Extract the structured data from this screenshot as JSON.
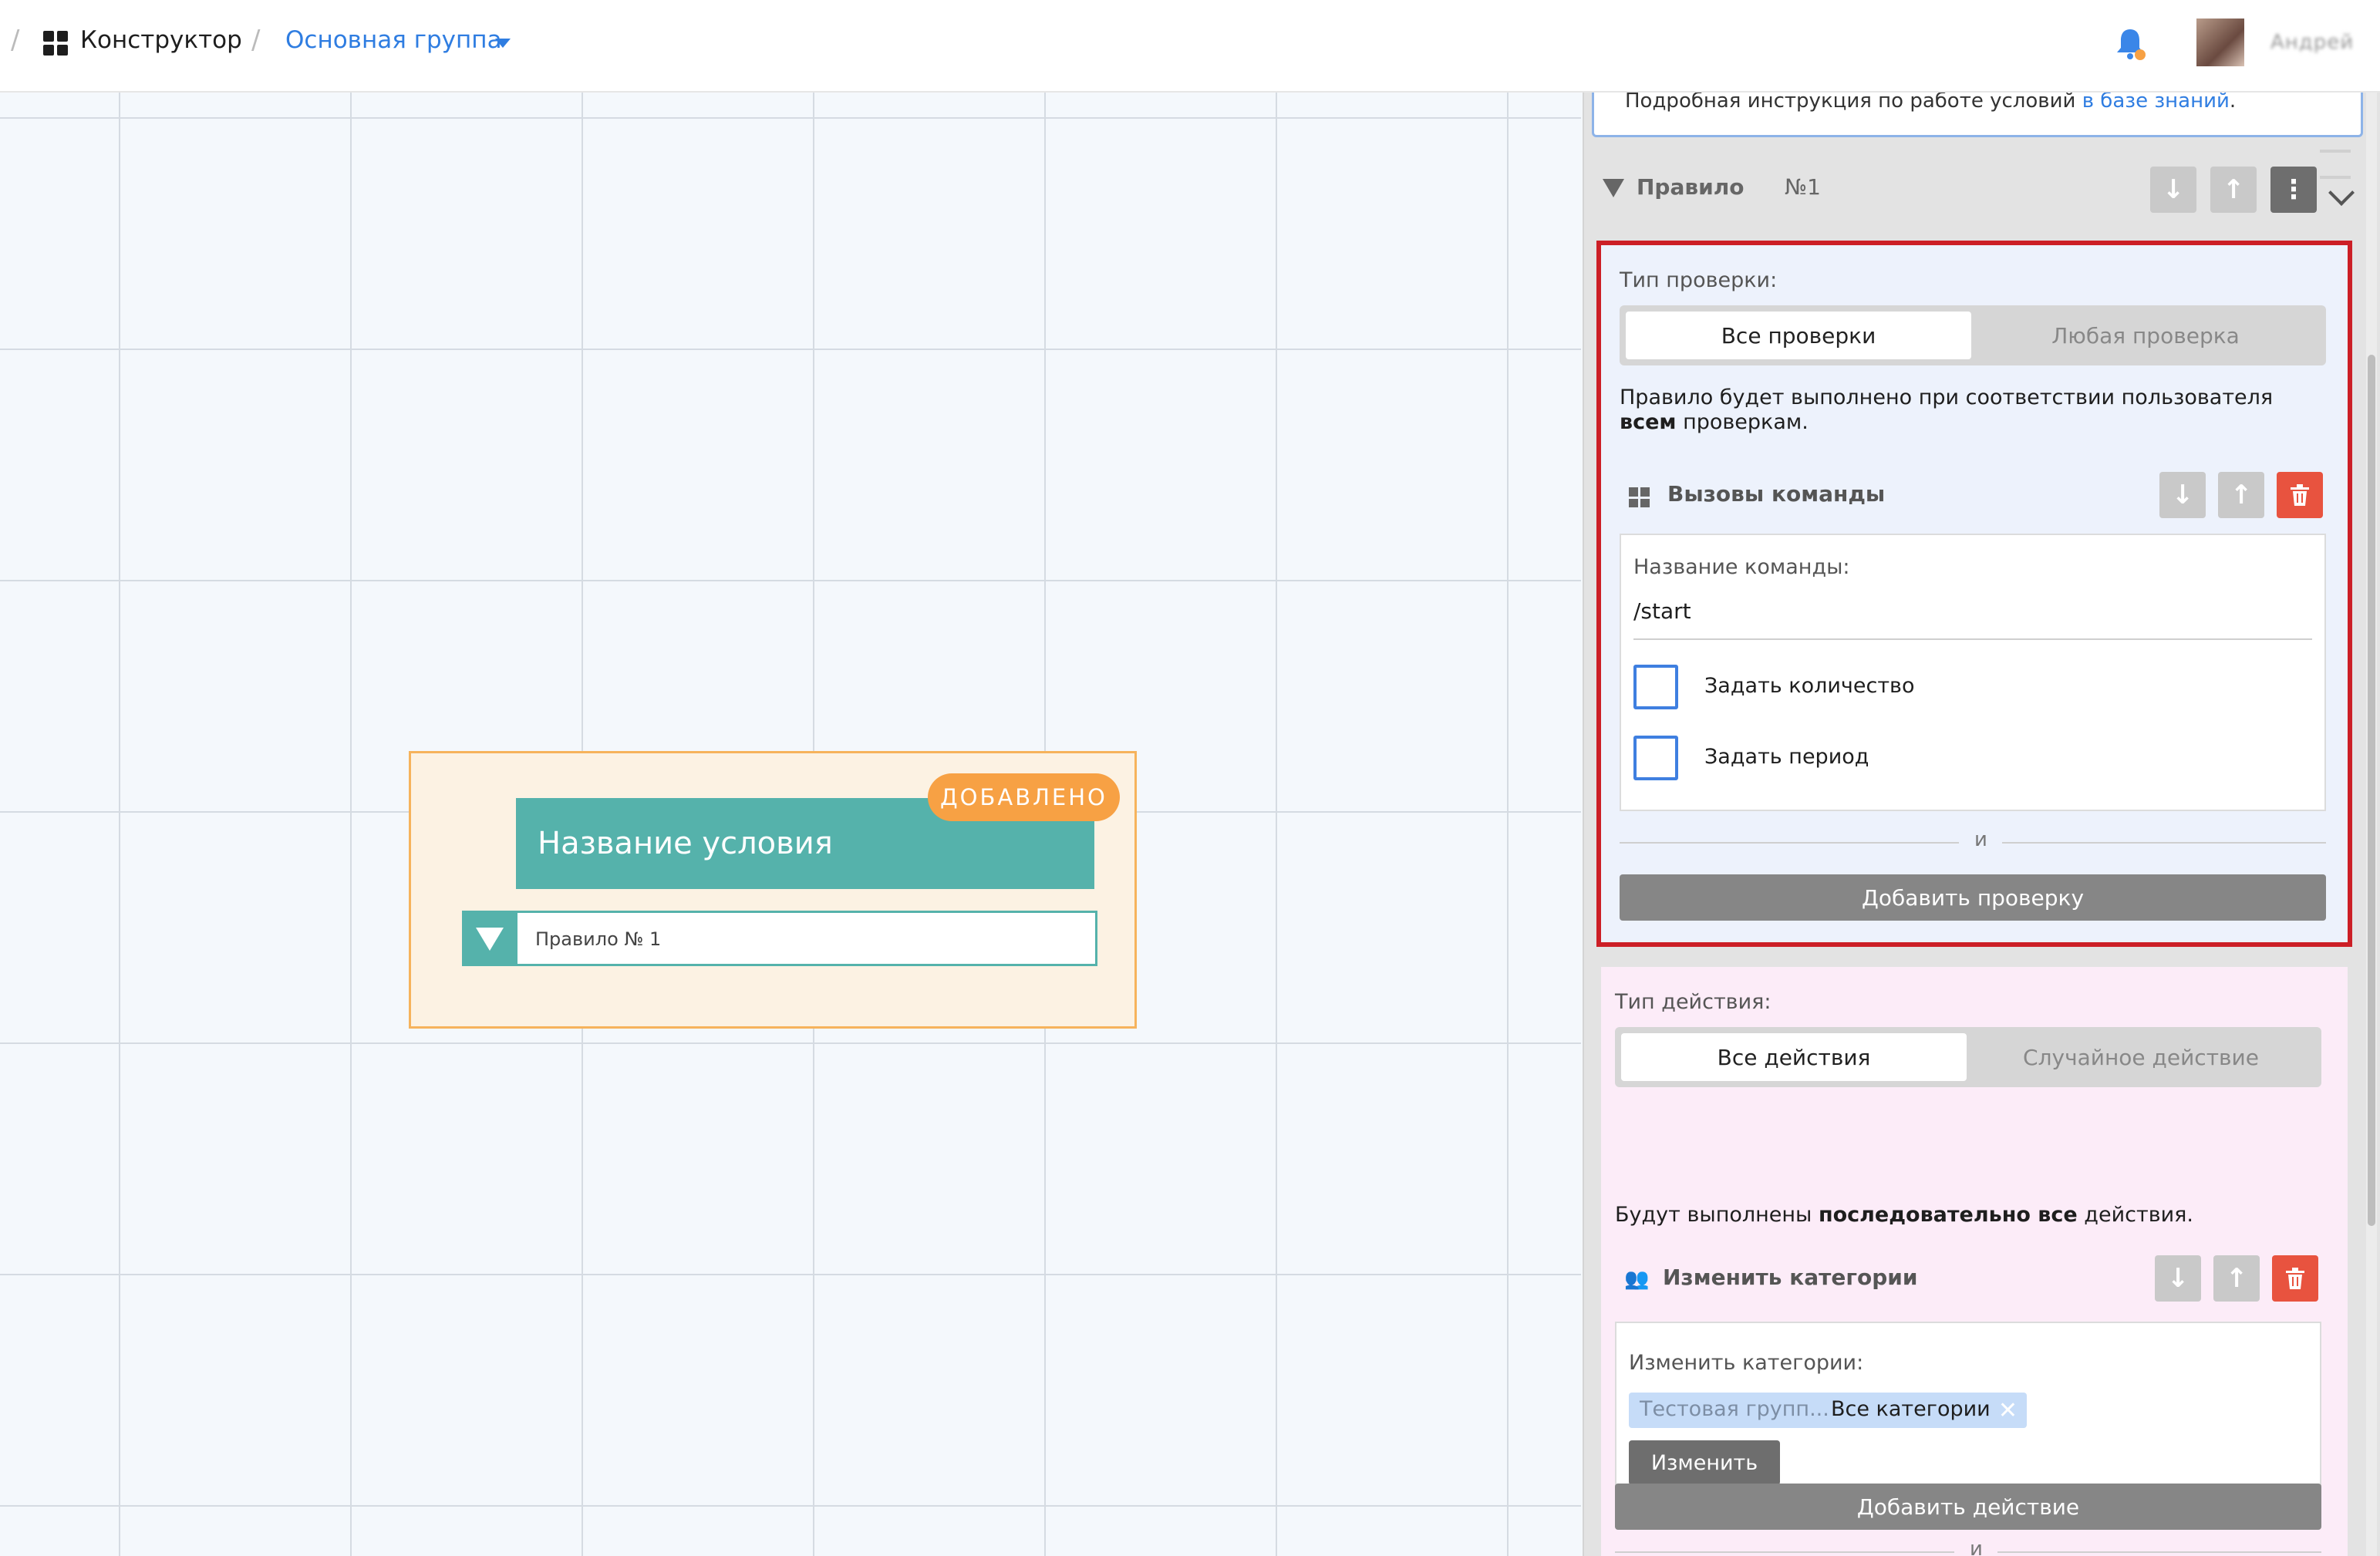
{
  "topbar": {
    "breadcrumb_root": "Конструктор",
    "breadcrumb_group": "Основная группа",
    "username": "Андрей"
  },
  "canvas": {
    "node_title": "Название условия",
    "node_badge": "ДОБАВЛЕНО",
    "node_rule_label": "Правило № 1"
  },
  "panel": {
    "info_text": "Подробная инструкция по работе условий ",
    "info_link": "в базе знаний",
    "info_tail": ".",
    "rule_title": "Правило",
    "rule_number": "№1",
    "check": {
      "type_label": "Тип проверки:",
      "options": [
        "Все проверки",
        "Любая проверка"
      ],
      "selected": "Все проверки",
      "desc_prefix": "Правило будет выполнено при соответствии пользователя ",
      "desc_bold": "всем",
      "desc_suffix": " проверкам.",
      "item_title": "Вызовы команды",
      "command_label": "Название команды:",
      "command_value": "/start",
      "checkbox_count": "Задать количество",
      "checkbox_period": "Задать период",
      "and_label": "и",
      "add_button": "Добавить проверку"
    },
    "action": {
      "type_label": "Тип действия:",
      "options": [
        "Все действия",
        "Случайное действие"
      ],
      "selected": "Все действия",
      "desc_prefix": "Будут выполнены ",
      "desc_bold": "последовательно все",
      "desc_suffix": " действия.",
      "item_title": "Изменить категории",
      "categories_label": "Изменить категории:",
      "chip_group": "Тестовая групп...",
      "chip_value": "Все категории",
      "change_button": "Изменить",
      "and_label": "и",
      "add_button": "Добавить действие"
    }
  },
  "colors": {
    "accent_blue": "#2f7de1",
    "node_teal": "#55b2ab",
    "badge_orange": "#f7a144",
    "highlight_red": "#cc1f26",
    "delete_red": "#e8533f"
  },
  "icons": [
    "grid-icon",
    "caret-down-icon",
    "bell-icon",
    "arrow-down-icon",
    "arrow-up-icon",
    "more-vertical-icon",
    "chevron-down-icon",
    "trash-icon",
    "people-icon",
    "close-icon",
    "filter-triangle-icon"
  ]
}
